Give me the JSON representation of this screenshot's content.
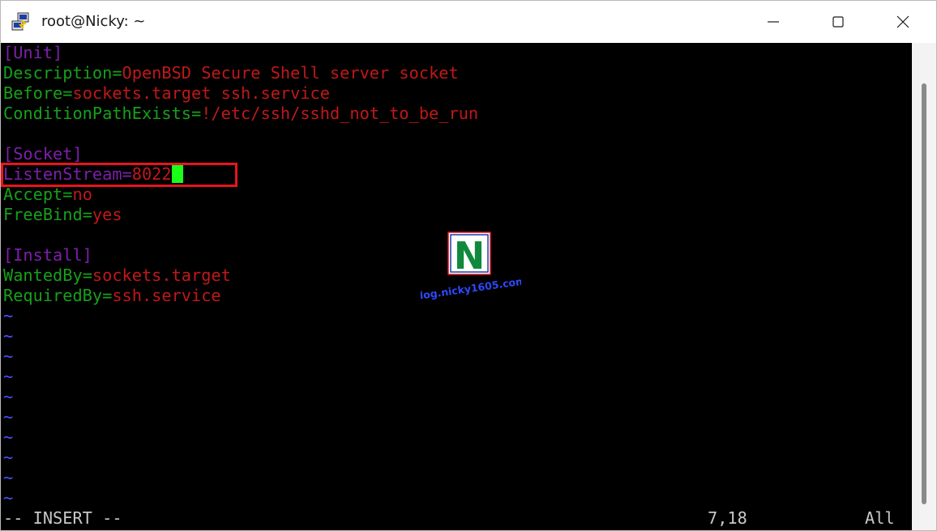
{
  "window": {
    "title": "root@Nicky: ~"
  },
  "editor": {
    "lines": [
      {
        "section": "[Unit]"
      },
      {
        "key": "Description",
        "sep": "=",
        "value": "OpenBSD Secure Shell server socket"
      },
      {
        "key": "Before",
        "sep": "=",
        "value": "sockets.target ssh.service"
      },
      {
        "key": "ConditionPathExists",
        "sep": "=",
        "value": "!/etc/ssh/sshd_not_to_be_run"
      },
      {
        "section": "[Socket]"
      },
      {
        "key": "ListenStream",
        "sep": "=",
        "value": "8022"
      },
      {
        "key": "Accept",
        "sep": "=",
        "value": "no"
      },
      {
        "key": "FreeBind",
        "sep": "=",
        "value": "yes"
      },
      {
        "section": "[Install]"
      },
      {
        "key": "WantedBy",
        "sep": "=",
        "value": "sockets.target"
      },
      {
        "key": "RequiredBy",
        "sep": "=",
        "value": "ssh.service"
      }
    ],
    "tilde": "~"
  },
  "status": {
    "mode": "-- INSERT --",
    "position": "7,18",
    "scroll": "All"
  },
  "watermark": {
    "logo_letter": "N",
    "text": "blog.nicky1605.com"
  },
  "colors": {
    "key": "#16a01a",
    "section": "#7d1faa",
    "value": "#c01818",
    "tilde": "#5050ff",
    "cursor": "#18ff18",
    "highlight": "#e8141e"
  }
}
